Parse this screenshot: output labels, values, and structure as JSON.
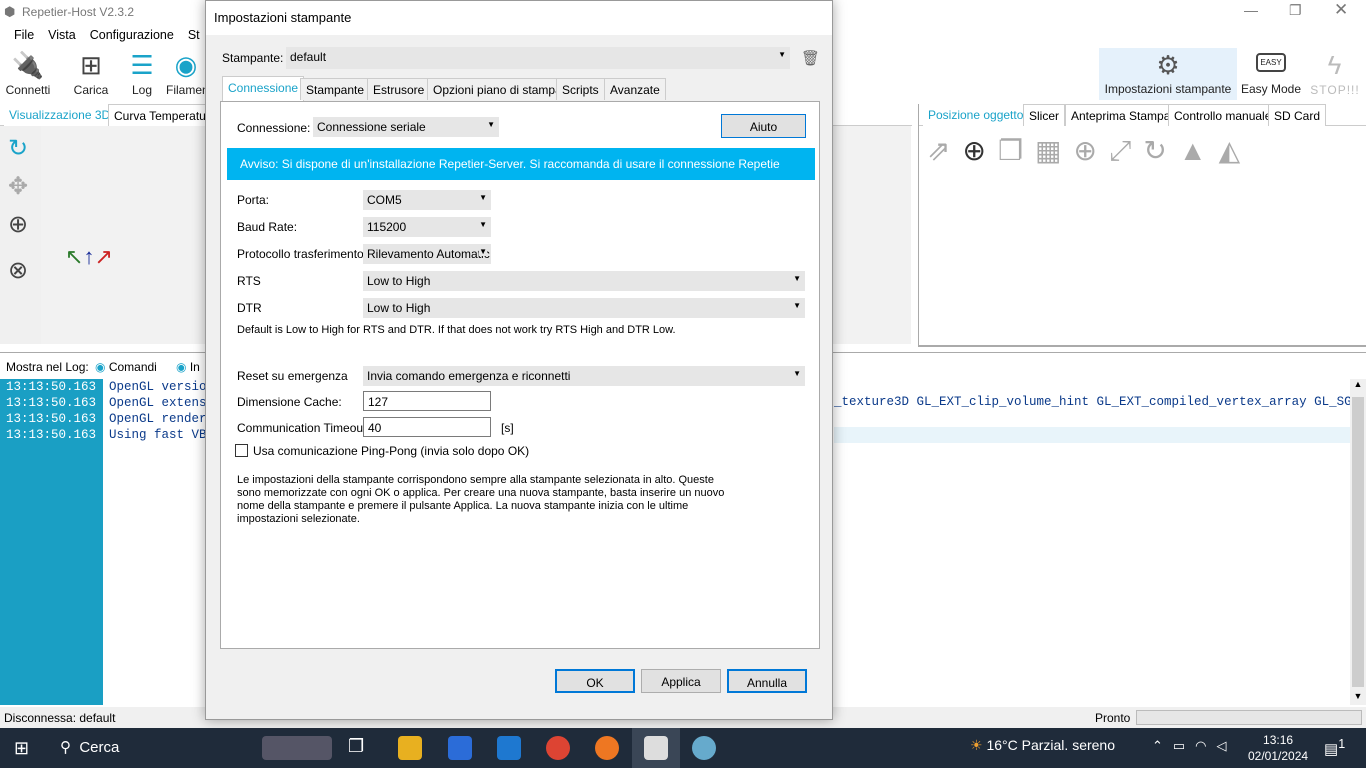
{
  "app": {
    "title": "Repetier-Host V2.3.2",
    "menu": [
      "File",
      "Vista",
      "Configurazione",
      "St"
    ],
    "toolbar": [
      "Connetti",
      "Carica",
      "Log",
      "Filamen"
    ],
    "right_toolbar": {
      "printer_settings": "Impostazioni stampante",
      "easy_mode": "Easy Mode",
      "easy_badge": "EASY",
      "stop": "STOP!!!"
    },
    "left_tabs": [
      "Visualizzazione 3D",
      "Curva Temperatura"
    ],
    "right_tabs": [
      "Posizione oggetto",
      "Slicer",
      "Anteprima Stampa",
      "Controllo manuale",
      "SD Card"
    ],
    "log_label": "Mostra nel Log:",
    "log_filters": [
      "Comandi",
      "In"
    ],
    "log": [
      {
        "time": "13:13:50.163",
        "msg": "OpenGL versio"
      },
      {
        "time": "13:13:50.163",
        "msg": "OpenGL extens"
      },
      {
        "time": "13:13:50.163",
        "msg": "OpenGL render"
      },
      {
        "time": "13:13:50.163",
        "msg": "Using fast VB"
      }
    ],
    "log_overflow": "_texture3D GL_EXT_clip_volume_hint GL_EXT_compiled_vertex_array GL_SGI",
    "status_left": "Disconnessa: default",
    "status_right": "Pronto"
  },
  "dialog": {
    "title": "Impostazioni stampante",
    "printer_label": "Stampante:",
    "printer_value": "default",
    "tabs": [
      "Connessione",
      "Stampante",
      "Estrusore",
      "Opzioni piano di stampa",
      "Scripts",
      "Avanzate"
    ],
    "connection_label": "Connessione:",
    "connection_value": "Connessione seriale",
    "help": "Aiuto",
    "warning": "Avviso: Si dispone di un'installazione Repetier-Server. Si raccomanda di usare il connessione Repetie",
    "port_label": "Porta:",
    "port": "COM5",
    "baud_label": "Baud Rate:",
    "baud": "115200",
    "protocol_label": "Protocollo trasferimento:",
    "protocol": "Rilevamento Automatic",
    "rts_label": "RTS",
    "rts": "Low to High",
    "dtr_label": "DTR",
    "dtr": "Low to High",
    "hint": "Default is Low to High for RTS and DTR. If that does not work try RTS High and DTR Low.",
    "reset_label": "Reset su emergenza",
    "reset": "Invia comando emergenza e riconnetti",
    "cache_label": "Dimensione Cache:",
    "cache": "127",
    "timeout_label": "Communication Timeout:",
    "timeout": "40",
    "timeout_unit": "[s]",
    "pingpong": "Usa comunicazione Ping-Pong (invia solo dopo OK)",
    "pingpong_checked": false,
    "info": "Le impostazioni della stampante corrispondono sempre alla stampante selezionata in alto. Queste sono memorizzate con ogni OK o applica. Per creare una nuova stampante, basta inserire un nuovo nome della stampante e premere il pulsante Applica. La nuova stampante inizia con le ultime impostazioni selezionate.",
    "ok": "OK",
    "apply": "Applica",
    "cancel": "Annulla"
  },
  "taskbar": {
    "search": "Cerca",
    "weather": "16°C  Parzial. sereno",
    "time": "13:16",
    "date": "02/01/2024",
    "notif": "1"
  }
}
